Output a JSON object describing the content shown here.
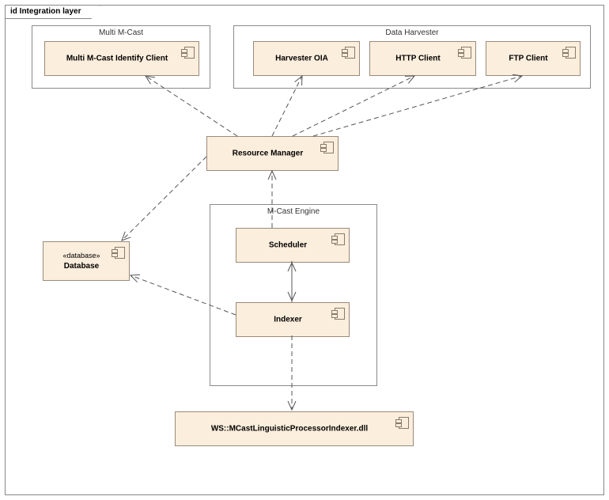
{
  "diagram": {
    "frame_title": "id Integration layer"
  },
  "packages": {
    "multi_mcast": {
      "title": "Multi M-Cast"
    },
    "data_harvester": {
      "title": "Data Harvester"
    },
    "mcast_engine": {
      "title": "M-Cast Engine"
    }
  },
  "components": {
    "identify_client": {
      "label": "Multi M-Cast Identify Client"
    },
    "harvester_oia": {
      "label": "Harvester OIA"
    },
    "http_client": {
      "label": "HTTP Client"
    },
    "ftp_client": {
      "label": "FTP Client"
    },
    "resource_manager": {
      "label": "Resource Manager"
    },
    "scheduler": {
      "label": "Scheduler"
    },
    "indexer": {
      "label": "Indexer"
    },
    "database": {
      "stereo": "«database»",
      "label": "Database"
    },
    "linguistic": {
      "label": "WS::MCastLinguisticProcessorIndexer.dll"
    }
  }
}
